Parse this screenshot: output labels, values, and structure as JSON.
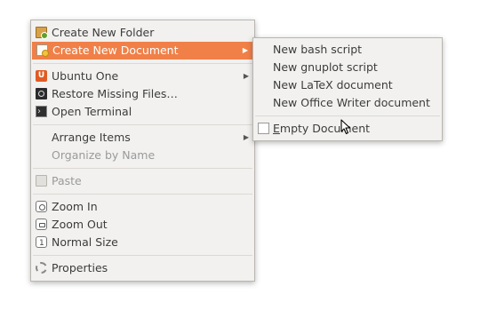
{
  "main_menu": {
    "items": [
      {
        "label": "Create New Folder",
        "icon": "folder-new-icon"
      },
      {
        "label": "Create New Document",
        "icon": "document-new-icon"
      },
      {
        "label": "Ubuntu One",
        "icon": "ubuntu-one-icon"
      },
      {
        "label": "Restore Missing Files…",
        "icon": "restore-icon"
      },
      {
        "label": "Open Terminal",
        "icon": "terminal-icon"
      },
      {
        "label": "Arrange Items"
      },
      {
        "label": "Organize by Name"
      },
      {
        "label": "Paste",
        "icon": "paste-icon"
      },
      {
        "label": "Zoom In",
        "icon": "zoom-in-icon"
      },
      {
        "label": "Zoom Out",
        "icon": "zoom-out-icon"
      },
      {
        "label": "Normal Size",
        "icon": "zoom-normal-icon"
      },
      {
        "label": "Properties",
        "icon": "properties-icon"
      }
    ]
  },
  "sub_menu": {
    "items": [
      {
        "label": "New bash script"
      },
      {
        "label": "New gnuplot script"
      },
      {
        "label": "New LaTeX document"
      },
      {
        "label": "New Office Writer document"
      }
    ],
    "empty_document": {
      "prefix": "E",
      "rest": "mpty Document",
      "icon": "empty-document-icon"
    }
  },
  "colors": {
    "highlight": "#f08048",
    "menu_bg": "#f2f1ef"
  }
}
